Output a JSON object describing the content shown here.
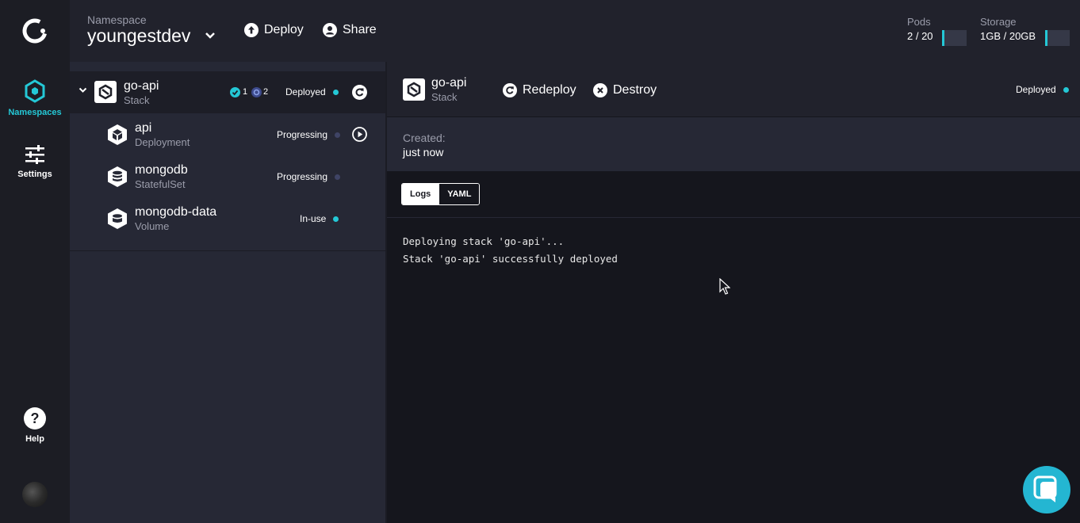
{
  "nav": {
    "namespaces_label": "Namespaces",
    "settings_label": "Settings",
    "help_label": "Help",
    "help_glyph": "?"
  },
  "topbar": {
    "namespace_label": "Namespace",
    "namespace_name": "youngestdev",
    "deploy_label": "Deploy",
    "share_label": "Share",
    "pods": {
      "label": "Pods",
      "value": "2 / 20",
      "fraction": 0.1
    },
    "storage": {
      "label": "Storage",
      "value": "1GB / 20GB",
      "fraction": 0.05
    }
  },
  "list": {
    "stack": {
      "name": "go-api",
      "type": "Stack",
      "ready_count": "1",
      "progress_count": "2",
      "status": "Deployed",
      "status_color": "#24c8d6"
    },
    "items": [
      {
        "name": "api",
        "type": "Deployment",
        "status": "Progressing",
        "status_color": "#3f4465",
        "icon": "cube-icon",
        "action": "play-icon"
      },
      {
        "name": "mongodb",
        "type": "StatefulSet",
        "status": "Progressing",
        "status_color": "#3f4465",
        "icon": "database-icon"
      },
      {
        "name": "mongodb-data",
        "type": "Volume",
        "status": "In-use",
        "status_color": "#24c8d6",
        "icon": "volume-icon"
      }
    ]
  },
  "detail": {
    "name": "go-api",
    "type": "Stack",
    "redeploy_label": "Redeploy",
    "destroy_label": "Destroy",
    "status": "Deployed",
    "created_label": "Created:",
    "created_value": "just now",
    "tabs": [
      "Logs",
      "YAML"
    ],
    "active_tab": "Logs",
    "logs": [
      "Deploying stack 'go-api'...",
      "Stack 'go-api' successfully deployed"
    ]
  },
  "colors": {
    "accent": "#24c8d6",
    "sidebar_bg": "#1c1d24",
    "panel_bg": "#262835",
    "main_bg": "#15161d",
    "progressing": "#3f4465"
  }
}
